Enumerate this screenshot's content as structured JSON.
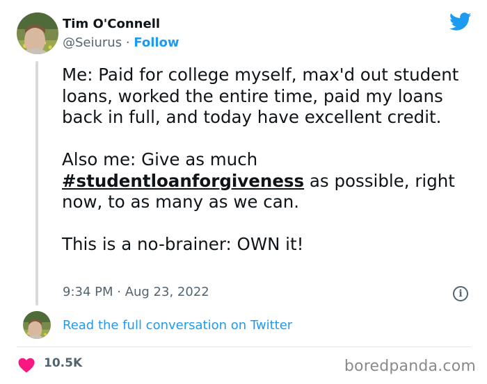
{
  "author": {
    "name": "Tim O'Connell",
    "handle": "@Seiurus",
    "separator": " · ",
    "follow_label": "Follow"
  },
  "tweet": {
    "paragraph_1": "Me: Paid for college myself, max'd out student loans, worked the entire time, paid my loans back in full, and today have excellent credit.",
    "paragraph_2_prefix": "Also me: Give as much ",
    "hashtag": "#studentloanforgiveness",
    "paragraph_2_suffix": " as possible, right now, to as many as we can.",
    "paragraph_3": "This is a no-brainer: OWN it!"
  },
  "timestamp": "9:34 PM · Aug 23, 2022",
  "info_glyph": "i",
  "read_link": "Read the full conversation on Twitter",
  "likes": "10.5K",
  "watermark": "boredpanda.com",
  "icons": {
    "brand": "twitter-bird-icon",
    "info": "info-icon",
    "like": "heart-icon"
  },
  "colors": {
    "link_blue": "#1d9bf0",
    "heart_pink": "#f91880",
    "text": "#0f1419",
    "muted": "#536471"
  }
}
